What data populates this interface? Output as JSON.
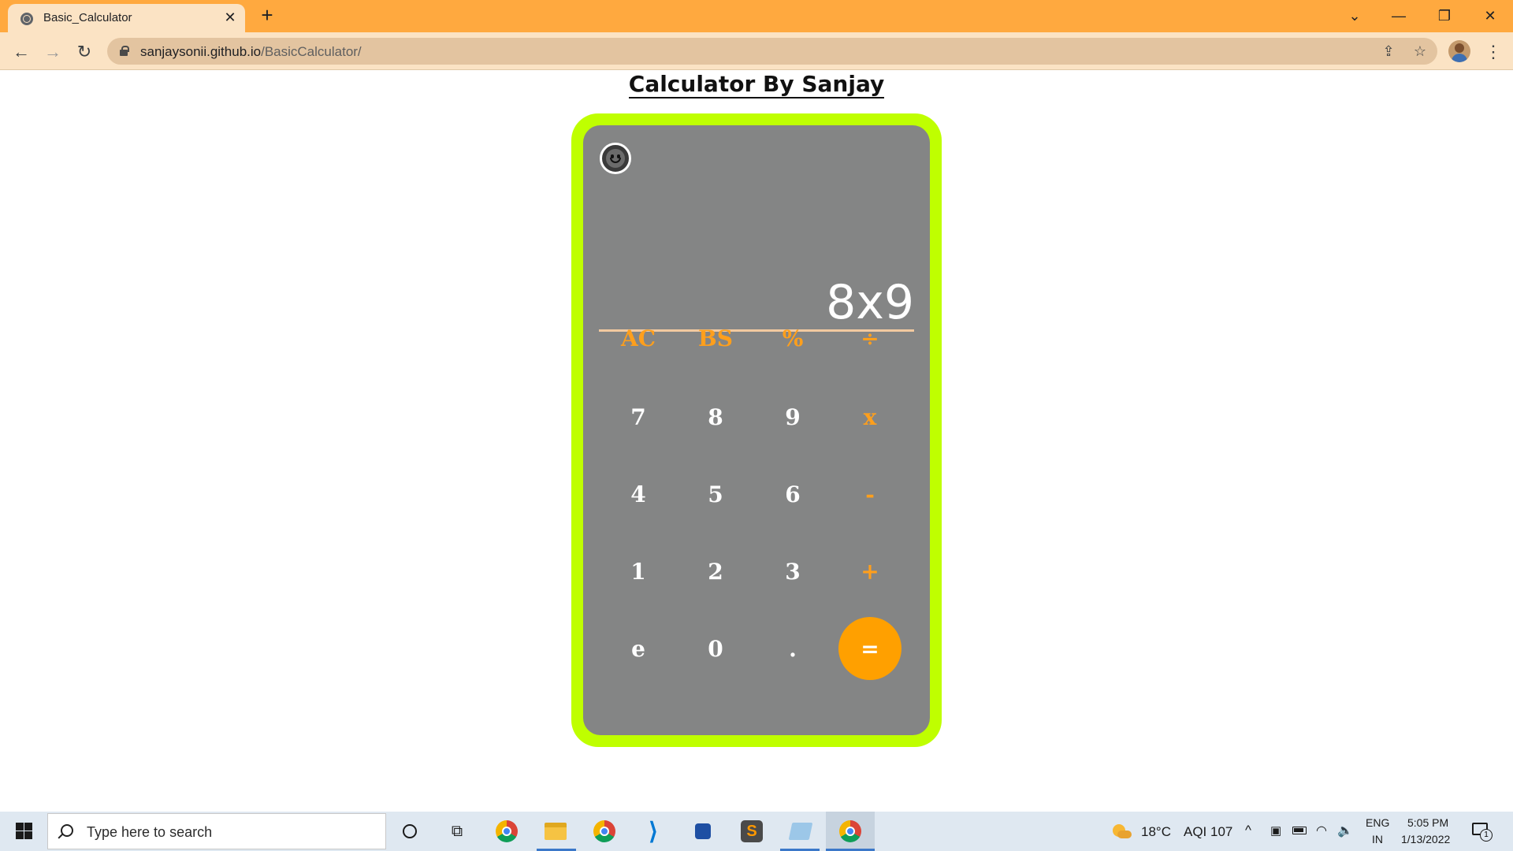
{
  "browser": {
    "tab_title": "Basic_Calculator",
    "tab_close": "✕",
    "new_tab": "+",
    "url_host": "sanjaysonii.github.io",
    "url_path": "/BasicCalculator/",
    "window_controls": {
      "dropdown": "⌄",
      "minimize": "—",
      "restore": "❐",
      "close": "✕"
    },
    "nav": {
      "back": "←",
      "forward": "→",
      "reload": "↻"
    },
    "omni_icons": {
      "share": "⇪",
      "bookmark": "☆"
    },
    "menu": "⋮"
  },
  "page": {
    "title": "Calculator By Sanjay"
  },
  "calculator": {
    "display": "8x9",
    "keys": [
      {
        "label": "AC",
        "kind": "op"
      },
      {
        "label": "BS",
        "kind": "op"
      },
      {
        "label": "%",
        "kind": "op"
      },
      {
        "label": "÷",
        "kind": "op"
      },
      {
        "label": "7",
        "kind": "num"
      },
      {
        "label": "8",
        "kind": "num"
      },
      {
        "label": "9",
        "kind": "num"
      },
      {
        "label": "x",
        "kind": "op"
      },
      {
        "label": "4",
        "kind": "num"
      },
      {
        "label": "5",
        "kind": "num"
      },
      {
        "label": "6",
        "kind": "num"
      },
      {
        "label": "-",
        "kind": "op"
      },
      {
        "label": "1",
        "kind": "num"
      },
      {
        "label": "2",
        "kind": "num"
      },
      {
        "label": "3",
        "kind": "num"
      },
      {
        "label": "+",
        "kind": "op"
      },
      {
        "label": "e",
        "kind": "num"
      },
      {
        "label": "0",
        "kind": "num"
      },
      {
        "label": ".",
        "kind": "num"
      },
      {
        "label": "=",
        "kind": "equals"
      }
    ],
    "colors": {
      "frame": "#bfff00",
      "body": "#848585",
      "operator": "#ff9f1c",
      "equals": "#ffa000"
    }
  },
  "taskbar": {
    "search_placeholder": "Type here to search",
    "weather": "18°C",
    "aqi": "AQI 107",
    "lang_top": "ENG",
    "lang_bottom": "IN",
    "time": "5:05 PM",
    "date": "1/13/2022",
    "notification_count": "1",
    "tray_chevron": "^",
    "apps": [
      "chrome-icon",
      "file-explorer-icon",
      "chrome-icon",
      "vscode-icon",
      "app-icon",
      "sublime-icon",
      "paint-icon",
      "chrome-icon"
    ]
  }
}
